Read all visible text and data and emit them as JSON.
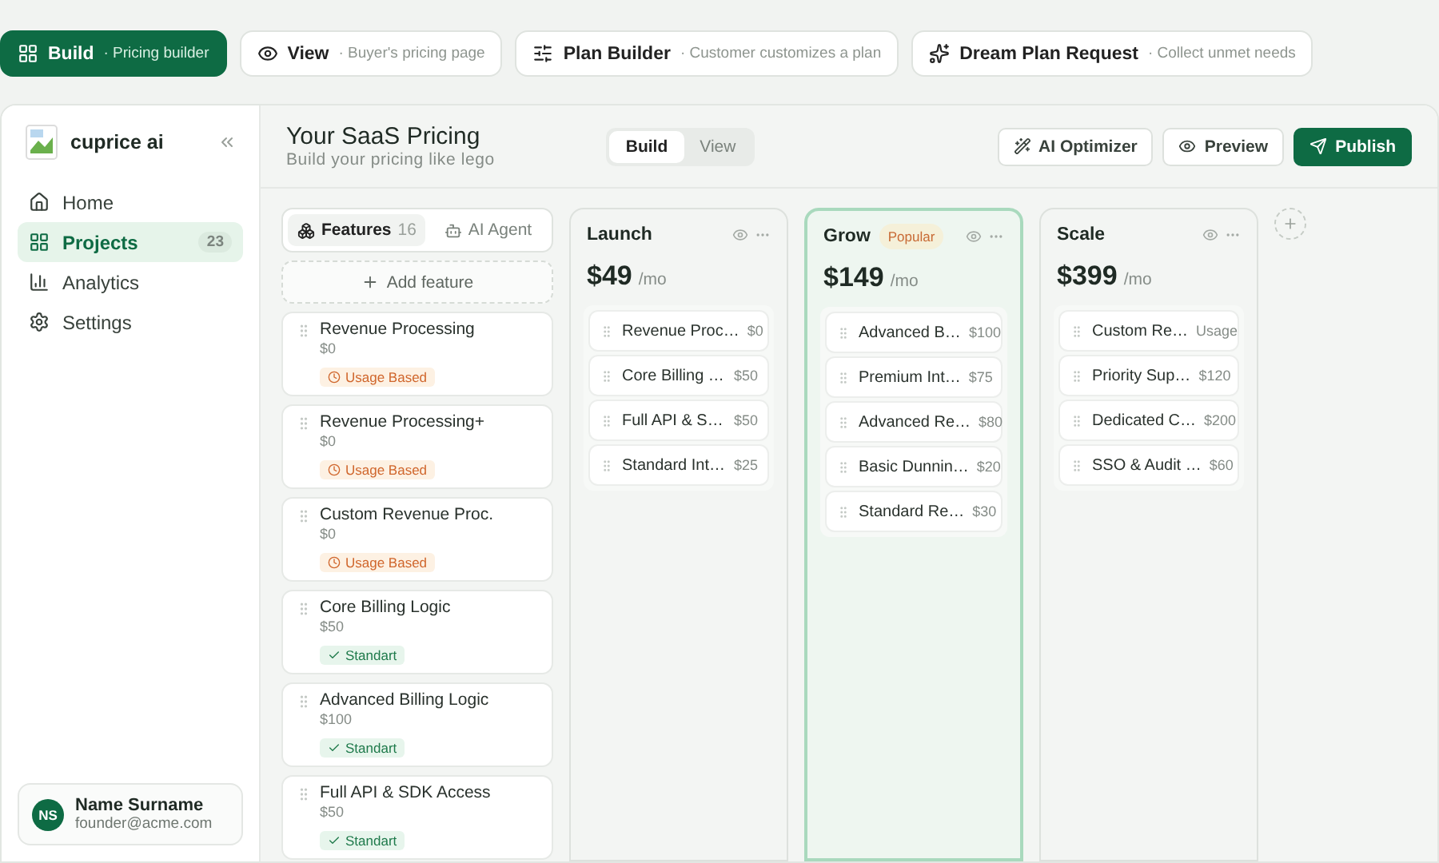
{
  "mode_tabs": [
    {
      "kind": "build",
      "label": "Build",
      "sublabel": "· Pricing builder",
      "selected": true
    },
    {
      "kind": "view",
      "label": "View",
      "sublabel": "· Buyer's pricing page",
      "selected": false
    },
    {
      "kind": "plan",
      "label": "Plan Builder",
      "sublabel": "· Customer customizes a plan",
      "selected": false
    },
    {
      "kind": "dream",
      "label": "Dream Plan Request",
      "sublabel": "· Collect unmet needs",
      "selected": false
    }
  ],
  "sidebar": {
    "brand": "cuprice ai",
    "items": [
      {
        "kind": "home",
        "label": "Home",
        "selected": false
      },
      {
        "kind": "projects",
        "label": "Projects",
        "count": "23",
        "selected": true
      },
      {
        "kind": "analytics",
        "label": "Analytics",
        "selected": false
      },
      {
        "kind": "settings",
        "label": "Settings",
        "selected": false
      }
    ],
    "user": {
      "initials": "NS",
      "name": "Name Surname",
      "email": "founder@acme.com"
    }
  },
  "header": {
    "title": "Your SaaS Pricing",
    "subtitle": "Build your pricing like lego",
    "toggle": [
      {
        "label": "Build",
        "selected": true
      },
      {
        "label": "View",
        "selected": false
      }
    ],
    "actions": [
      {
        "kind": "optimizer",
        "label": "AI Optimizer"
      },
      {
        "kind": "preview",
        "label": "Preview"
      },
      {
        "kind": "publish",
        "label": "Publish"
      }
    ]
  },
  "feature_tabs": [
    {
      "kind": "features",
      "label": "Features",
      "count": "16",
      "selected": true
    },
    {
      "kind": "agent",
      "label": "AI Agent",
      "selected": false
    }
  ],
  "add_feature": "Add feature",
  "features": [
    {
      "name": "Revenue Processing",
      "price": "$0",
      "tag": {
        "kind": "usage",
        "label": "Usage Based"
      }
    },
    {
      "name": "Revenue Processing+",
      "price": "$0",
      "tag": {
        "kind": "usage",
        "label": "Usage Based"
      }
    },
    {
      "name": "Custom Revenue Proc.",
      "price": "$0",
      "tag": {
        "kind": "usage",
        "label": "Usage Based"
      }
    },
    {
      "name": "Core Billing Logic",
      "price": "$50",
      "tag": {
        "kind": "standard",
        "label": "Standart"
      }
    },
    {
      "name": "Advanced Billing Logic",
      "price": "$100",
      "tag": {
        "kind": "standard",
        "label": "Standart"
      }
    },
    {
      "name": "Full API & SDK Access",
      "price": "$50",
      "tag": {
        "kind": "standard",
        "label": "Standart"
      }
    }
  ],
  "plans": [
    {
      "name": "Launch",
      "price": "$49",
      "period": "/mo",
      "popular": false,
      "items": [
        {
          "name": "Revenue Proc…",
          "price": "$0"
        },
        {
          "name": "Core Billing …",
          "price": "$50"
        },
        {
          "name": "Full API & S…",
          "price": "$50"
        },
        {
          "name": "Standard Int…",
          "price": "$25"
        }
      ]
    },
    {
      "name": "Grow",
      "badge": "Popular",
      "price": "$149",
      "period": "/mo",
      "popular": true,
      "items": [
        {
          "name": "Advanced B…",
          "price": "$100"
        },
        {
          "name": "Premium Int…",
          "price": "$75"
        },
        {
          "name": "Advanced Re…",
          "price": "$80"
        },
        {
          "name": "Basic Dunnin…",
          "price": "$20"
        },
        {
          "name": "Standard Re…",
          "price": "$30"
        }
      ]
    },
    {
      "name": "Scale",
      "price": "$399",
      "period": "/mo",
      "popular": false,
      "items": [
        {
          "name": "Custom Re…",
          "price": "Usage"
        },
        {
          "name": "Priority Sup…",
          "price": "$120"
        },
        {
          "name": "Dedicated C…",
          "price": "$200"
        },
        {
          "name": "SSO & Audit …",
          "price": "$60"
        }
      ]
    }
  ]
}
